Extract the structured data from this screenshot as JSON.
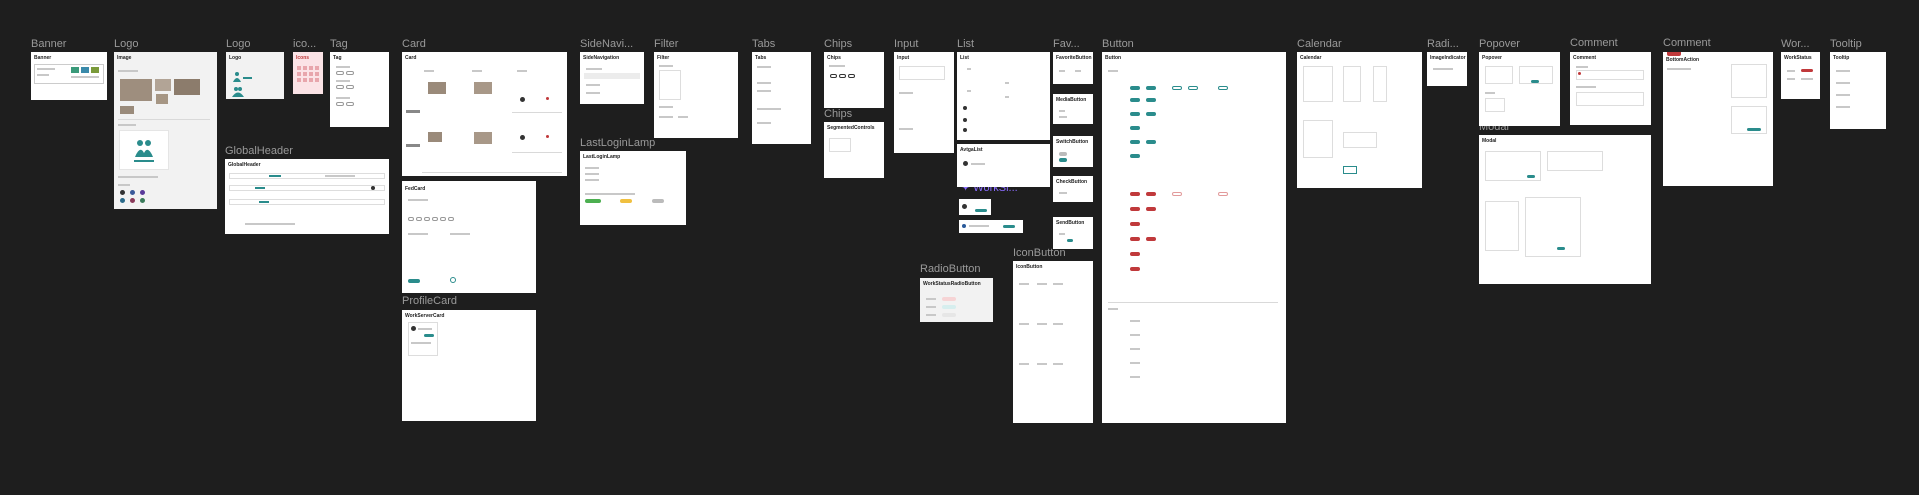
{
  "frames": {
    "banner": {
      "label": "Banner",
      "title": "Banner"
    },
    "logo1": {
      "label": "Logo",
      "title": "Image"
    },
    "logo2": {
      "label": "Logo",
      "title": "Logo"
    },
    "icon": {
      "label": "ico...",
      "title": "Icons"
    },
    "tag": {
      "label": "Tag",
      "title": "Tag"
    },
    "card": {
      "label": "Card",
      "title": "Card"
    },
    "globalheader": {
      "label": "GlobalHeader",
      "title": "GlobalHeader"
    },
    "fedcard": {
      "title": "FedCard"
    },
    "profilecard": {
      "label": "ProfileCard",
      "title": "WorkServerCard"
    },
    "sidenav": {
      "label": "SideNavi...",
      "title": "SideNavigation"
    },
    "filter": {
      "label": "Filter",
      "title": "Filter"
    },
    "lastlogin": {
      "label": "LastLoginLamp",
      "title": "LastLoginLamp"
    },
    "tabs": {
      "label": "Tabs",
      "title": "Tabs"
    },
    "chips1": {
      "label": "Chips",
      "title": "Chips"
    },
    "chips2": {
      "label": "Chips",
      "title": "SegmentedControls"
    },
    "input": {
      "label": "Input",
      "title": "Input"
    },
    "list": {
      "label": "List",
      "title": "List"
    },
    "avatarlist": {
      "title": "AvtgaList"
    },
    "worksi": {
      "label": "WorkSi..."
    },
    "radiobutton": {
      "label": "RadioButton",
      "title": "WorkStatusRadioButton"
    },
    "fav": {
      "label": "Fav...",
      "title": "FavoriteButton"
    },
    "mediabutton": {
      "title": "MediaButton"
    },
    "switchbutton": {
      "title": "SwitchButton"
    },
    "checkbutton": {
      "title": "CheckButton"
    },
    "sendbutton": {
      "title": "SendButton"
    },
    "iconbutton": {
      "label": "IconButton",
      "title": "IconButton"
    },
    "button": {
      "label": "Button",
      "title": "Button"
    },
    "calendar": {
      "label": "Calendar",
      "title": "Calendar"
    },
    "radio": {
      "label": "Radi...",
      "title": "ImageIndicator"
    },
    "popover": {
      "label": "Popover",
      "title": "Popover"
    },
    "modal": {
      "label": "Modal",
      "title": "Modal"
    },
    "comment1": {
      "label": "Comment",
      "title": "Comment"
    },
    "comment2": {
      "label": "Comment",
      "title": "BottomAction"
    },
    "wor": {
      "label": "Wor...",
      "title": "WorkStatus"
    },
    "tooltip": {
      "label": "Tooltip",
      "title": "Tooltip"
    }
  },
  "colors": {
    "canvas": "#1e1e1e",
    "label": "#9a9a9a",
    "accent": "#2a8c8c",
    "danger": "#c0393b",
    "purple": "#8a6cff"
  }
}
